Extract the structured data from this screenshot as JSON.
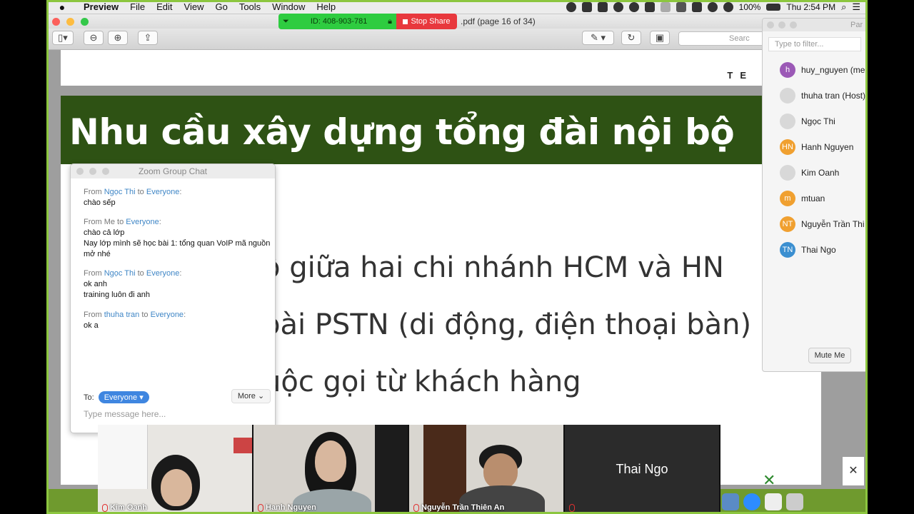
{
  "menubar": {
    "app": "Preview",
    "items": [
      "File",
      "Edit",
      "View",
      "Go",
      "Tools",
      "Window",
      "Help"
    ],
    "battery": "100%",
    "clock": "Thu 2:54 PM"
  },
  "share_bar": {
    "meeting_id": "ID: 408-903-781",
    "stop_label": "Stop Share"
  },
  "window": {
    "title": ".pdf (page 16 of 34)",
    "search_placeholder": "Searc"
  },
  "slide": {
    "logo_text": "TE",
    "title": "Nhu cầu xây dựng tổng đài nội bộ",
    "bullets": [
      "ộ giữa hai chi nhánh HCM và HN",
      "oài PSTN (di động, điện thoại bàn)",
      "uộc gọi từ khách hàng"
    ]
  },
  "participants": {
    "title": "Par",
    "filter_placeholder": "Type to filter...",
    "list": [
      {
        "initials": "h",
        "name": "huy_nguyen (me",
        "color": "#9b59b6"
      },
      {
        "initials": "",
        "name": "thuha tran (Host)",
        "color": "#d8d8d8"
      },
      {
        "initials": "",
        "name": "Ngọc Thi",
        "color": "#d8d8d8"
      },
      {
        "initials": "HN",
        "name": "Hanh Nguyen",
        "color": "#f0a030"
      },
      {
        "initials": "",
        "name": "Kim Oanh",
        "color": "#d8d8d8"
      },
      {
        "initials": "m",
        "name": "mtuan",
        "color": "#f0a030"
      },
      {
        "initials": "NT",
        "name": "Nguyễn Trần Thi",
        "color": "#f0a030"
      },
      {
        "initials": "TN",
        "name": "Thai Ngo",
        "color": "#3b8fd0"
      }
    ],
    "mute_label": "Mute Me"
  },
  "chat": {
    "title": "Zoom Group Chat",
    "messages": [
      {
        "from_prefix": "From ",
        "sender": "Ngọc Thi",
        "to_word": " to ",
        "target": "Everyone",
        "colon": ":",
        "lines": [
          "chào sếp"
        ]
      },
      {
        "from_prefix": "From Me to ",
        "target": "Everyone",
        "colon": ":",
        "lines": [
          "chào cả lớp",
          "Nay lớp mình sẽ học bài 1: tổng quan VoIP mã nguồn mở nhé"
        ]
      },
      {
        "from_prefix": "From ",
        "sender": "Ngọc Thi",
        "to_word": " to ",
        "target": "Everyone",
        "colon": ":",
        "lines": [
          "ok anh",
          "training luôn đi anh"
        ]
      },
      {
        "from_prefix": "From ",
        "sender": "thuha tran",
        "to_word": " to ",
        "target": "Everyone",
        "colon": ":",
        "lines": [
          "ok a"
        ]
      }
    ],
    "to_label": "To:",
    "to_value": "Everyone ▾",
    "more_label": "More ⌄",
    "input_placeholder": "Type message here..."
  },
  "videos": [
    {
      "name": "Kim Oanh"
    },
    {
      "name": "Hanh Nguyen"
    },
    {
      "name": "Nguyễn Trần Thiên An"
    },
    {
      "name": "",
      "big_name": "Thai Ngo"
    }
  ],
  "close_symbol": "✕"
}
